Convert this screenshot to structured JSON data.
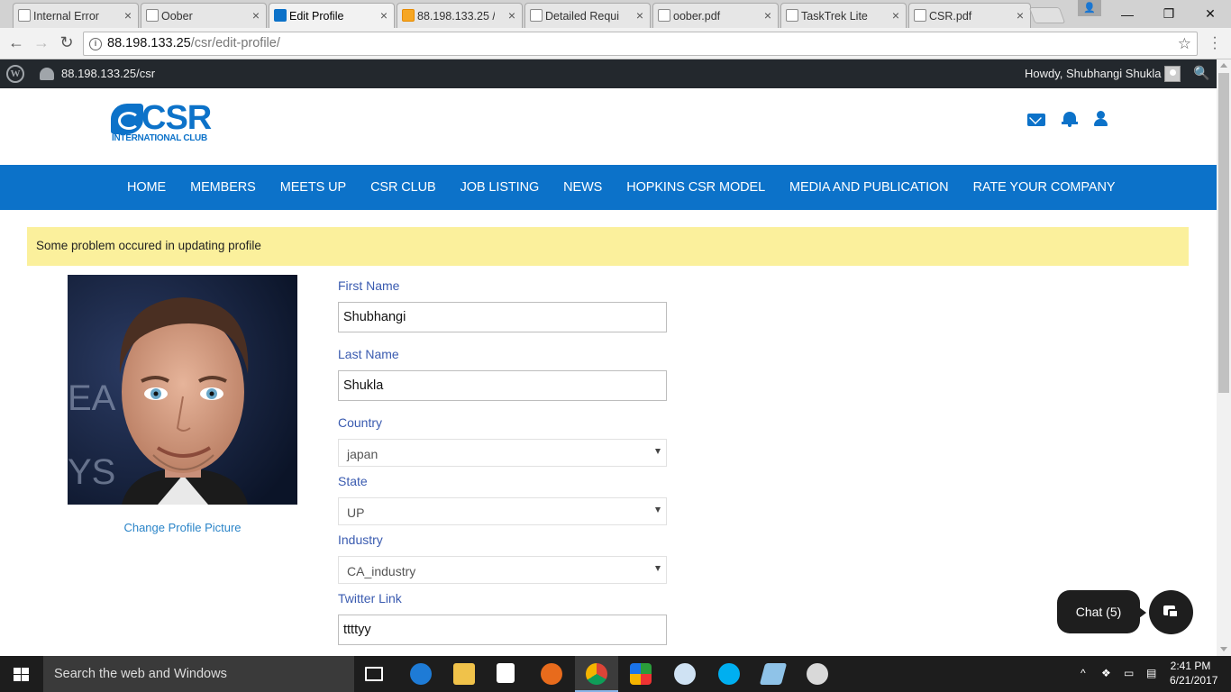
{
  "browser": {
    "tabs": [
      {
        "label": "Internal Error"
      },
      {
        "label": "Oober"
      },
      {
        "label": "Edit Profile"
      },
      {
        "label": "88.198.133.25 /"
      },
      {
        "label": "Detailed Requi"
      },
      {
        "label": "oober.pdf"
      },
      {
        "label": "TaskTrek Lite"
      },
      {
        "label": "CSR.pdf"
      }
    ],
    "url_host": "88.198.133.25",
    "url_path": "/csr/edit-profile/"
  },
  "adminbar": {
    "site": "88.198.133.25/csr",
    "howdy": "Howdy, Shubhangi Shukla"
  },
  "logo": {
    "text": "CSR",
    "subtext": "INTERNATIONAL CLUB"
  },
  "nav": [
    "HOME",
    "MEMBERS",
    "MEETS UP",
    "CSR CLUB",
    "JOB LISTING",
    "NEWS",
    "HOPKINS CSR MODEL",
    "MEDIA AND PUBLICATION",
    "RATE YOUR COMPANY"
  ],
  "alert": "Some problem occured in updating profile",
  "profile": {
    "change_picture": "Change Profile Picture"
  },
  "form": {
    "first_name_label": "First Name",
    "first_name": "Shubhangi",
    "last_name_label": "Last Name",
    "last_name": "Shukla",
    "country_label": "Country",
    "country": "japan",
    "state_label": "State",
    "state": "UP",
    "industry_label": "Industry",
    "industry": "CA_industry",
    "twitter_label": "Twitter Link",
    "twitter": "ttttyy"
  },
  "chat": {
    "label": "Chat (5)"
  },
  "taskbar": {
    "search_placeholder": "Search the web and Windows",
    "time": "2:41 PM",
    "date": "6/21/2017"
  },
  "colors": {
    "brand_blue": "#0c72c9",
    "alert_bg": "#fbf09c",
    "label_blue": "#3a5bb0"
  }
}
